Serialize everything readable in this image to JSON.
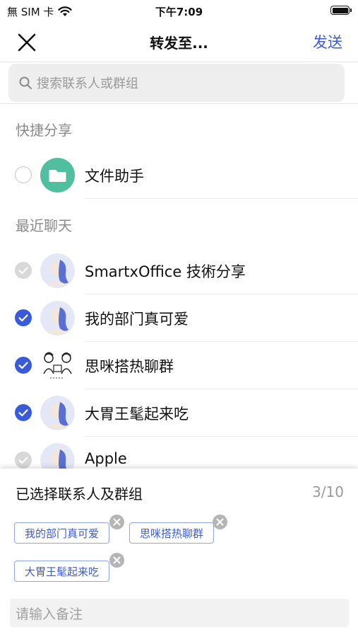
{
  "status_bar": {
    "carrier": "無 SIM 卡",
    "time": "下午7:09"
  },
  "nav": {
    "title": "转发至...",
    "send_label": "发送"
  },
  "search": {
    "placeholder": "搜索联系人或群组"
  },
  "sections": {
    "quick_share": "快捷分享",
    "recent_chats": "最近聊天"
  },
  "quick_share_items": [
    {
      "label": "文件助手",
      "state": "unchecked",
      "icon": "folder-icon",
      "color": "#4fbf9f"
    }
  ],
  "recent_items": [
    {
      "label": "SmartxOffice 技術分享",
      "state": "disabled"
    },
    {
      "label": "我的部门真可爱",
      "state": "checked"
    },
    {
      "label": "思咪搭热聊群",
      "state": "checked"
    },
    {
      "label": "大胃王髦起来吃",
      "state": "checked"
    },
    {
      "label": "Apple",
      "state": "disabled"
    }
  ],
  "selected_panel": {
    "title": "已选择联系人及群组",
    "count": "3/10",
    "chips": [
      "我的部门真可爱",
      "思咪搭热聊群",
      "大胃王髦起来吃"
    ],
    "note_placeholder": "请输入备注"
  },
  "colors": {
    "accent": "#3a5bd9",
    "folder": "#4fbf9f"
  }
}
